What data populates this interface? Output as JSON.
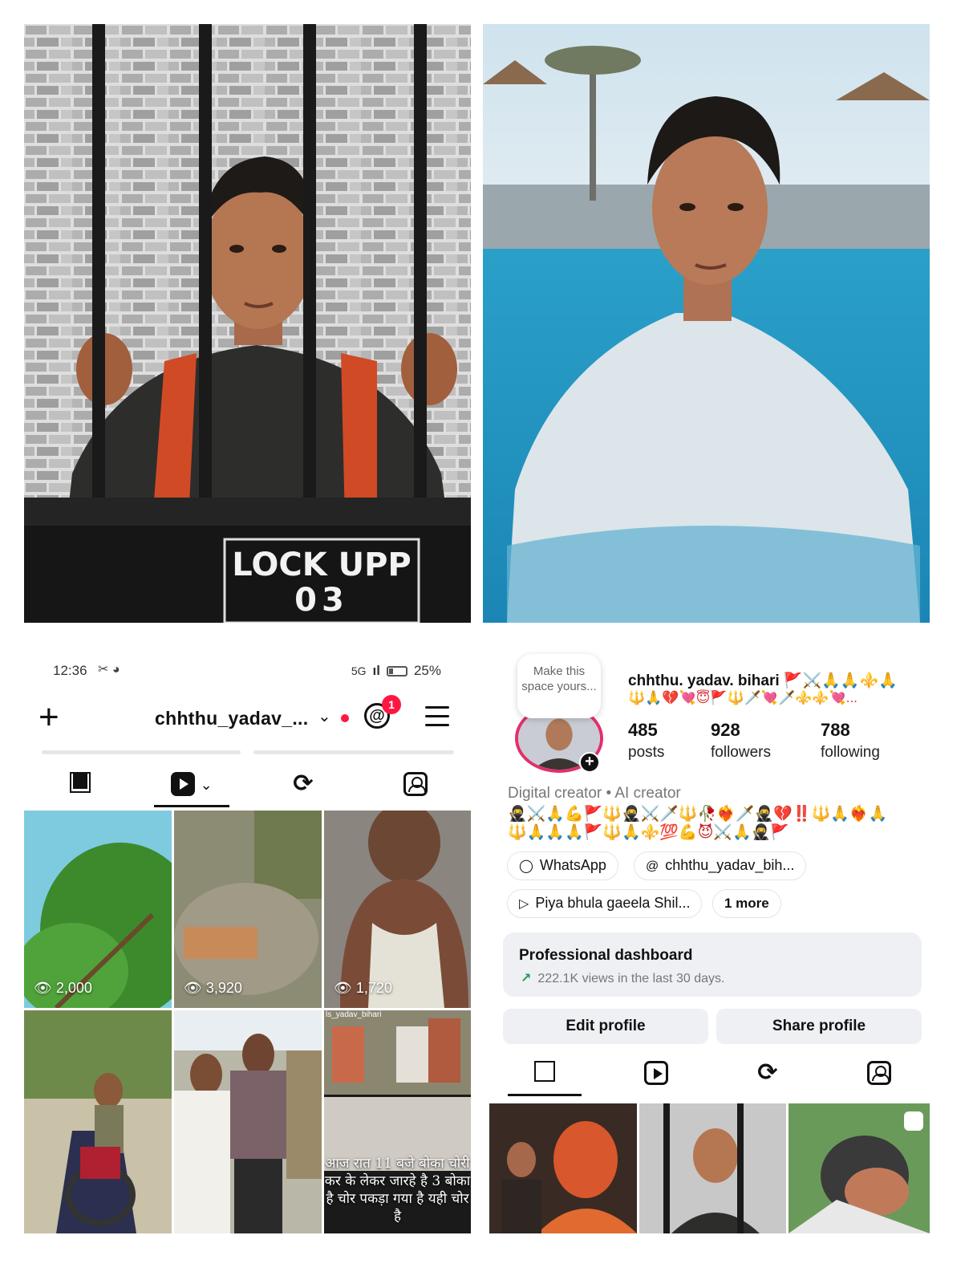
{
  "photos": {
    "jail_sign_line1": "LOCK UPP",
    "jail_sign_line2": "03"
  },
  "left_panel": {
    "status": {
      "time": "12:36",
      "time_icons": "✂ ◕",
      "network": "5G",
      "signal": "ıl",
      "battery": "25%"
    },
    "topbar": {
      "plus": "+",
      "username": "chhthu_yadav_...",
      "chevron": "⌄",
      "threads_icon": "@",
      "badge": "1"
    },
    "tabs": [
      "grid-icon",
      "reels-icon",
      "repost-icon",
      "tagged-icon"
    ],
    "grid": [
      {
        "views": "2,000"
      },
      {
        "views": "3,920"
      },
      {
        "views": "1,720"
      },
      {
        "views": ""
      },
      {
        "views": ""
      },
      {
        "views": ""
      }
    ],
    "caption_top": "ls_yadav_bihari",
    "caption": "आज रात 11 बजे बोका चोरी कर के लेकर जारहे है 3 बोका है चोर पकड़ा गया है यही चोर है"
  },
  "right_panel": {
    "note_bubble": "Make this space yours...",
    "avatar_plus": "+",
    "profile_name": "chhthu. yadav. bihari 🚩⚔️🙏🙏⚜️🙏",
    "profile_emoji_line": "🔱🙏💔💘😇🚩🔱🗡️💘🗡️⚜️⚜️💘...",
    "stats": [
      {
        "number": "485",
        "label": "posts"
      },
      {
        "number": "928",
        "label": "followers"
      },
      {
        "number": "788",
        "label": "following"
      }
    ],
    "category": "Digital creator • AI creator",
    "bio_line1": "🥷⚔️🙏💪🚩🔱🥷⚔️🗡️🔱🥀❤️‍🔥🗡️🥷💔‼️🔱🙏❤️‍🔥🙏",
    "bio_line2": "🔱🙏🙏🙏🚩🔱🙏⚜️💯💪😈⚔️🙏🥷🚩",
    "chips": [
      {
        "icon": "◯",
        "label": "WhatsApp"
      },
      {
        "icon": "@",
        "label": "chhthu_yadav_bih..."
      },
      {
        "icon": "▷",
        "label": "Piya bhula gaeela Shil..."
      },
      {
        "icon": "",
        "label": "1 more"
      }
    ],
    "dashboard": {
      "title": "Professional dashboard",
      "arrow": "↗",
      "subtitle": "222.1K views in the last 30 days."
    },
    "buttons": {
      "edit": "Edit profile",
      "share": "Share profile"
    },
    "tabs": [
      "grid-icon",
      "reels-icon",
      "repost-icon",
      "tagged-icon"
    ],
    "thumbnails": [
      "portrait-with-idol",
      "jail-bars-portrait",
      "blurred-reel"
    ]
  }
}
